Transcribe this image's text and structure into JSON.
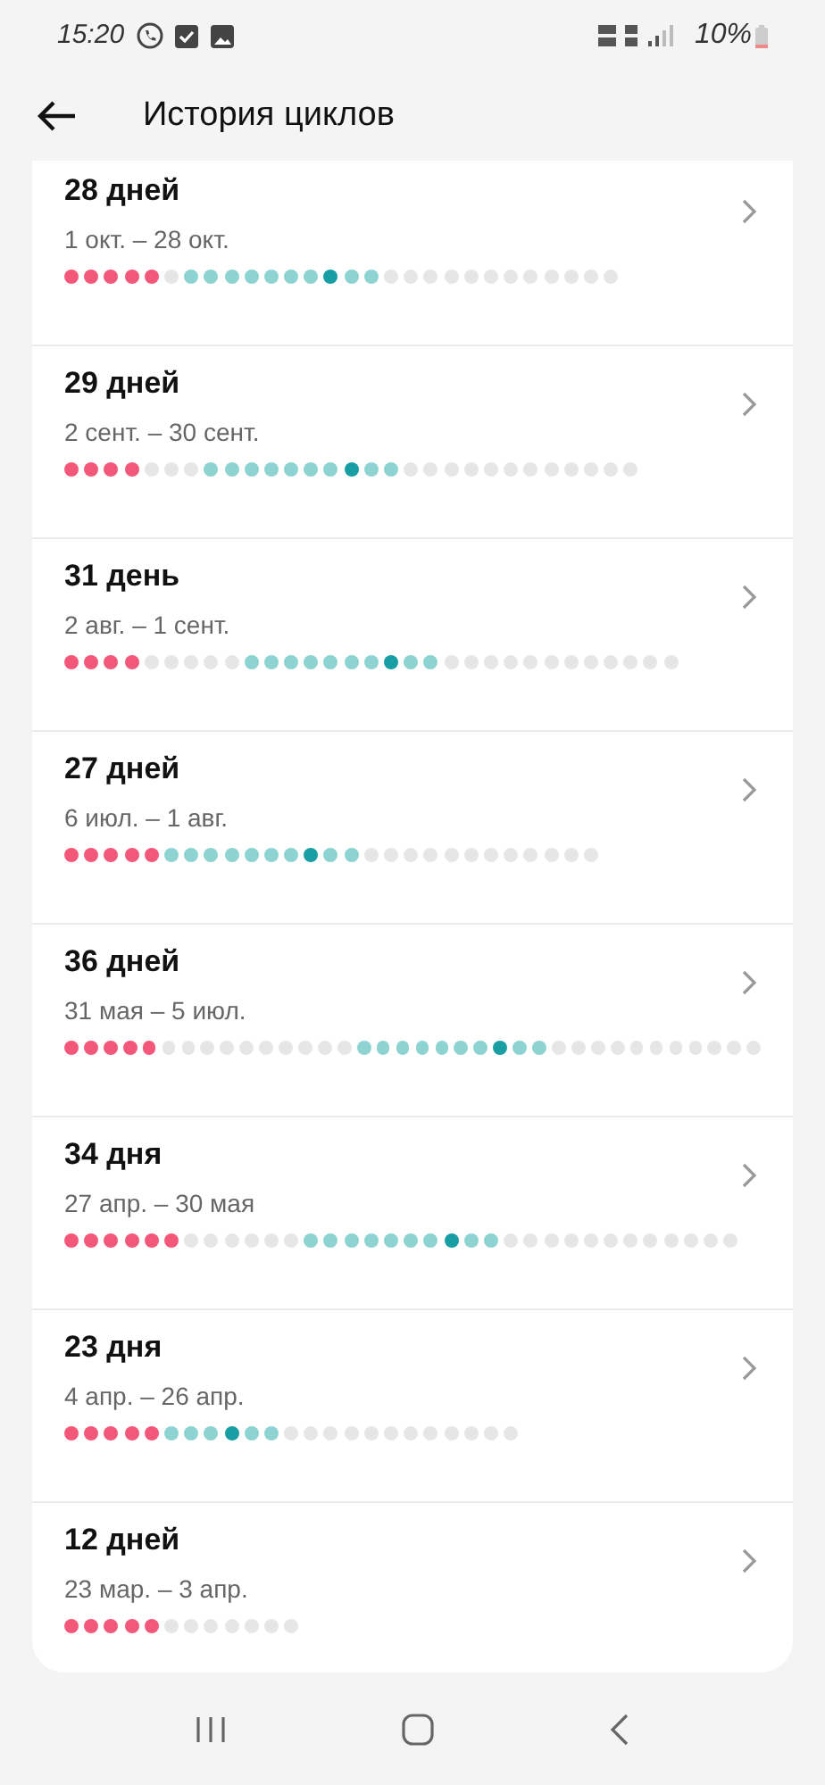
{
  "status_bar": {
    "time": "15:20",
    "battery": "10%"
  },
  "header": {
    "title": "История циклов"
  },
  "cycles": [
    {
      "length": "28 дней",
      "dates": "1 окт. – 28 окт.",
      "days": [
        {
          "kind": "period"
        },
        {
          "kind": "period"
        },
        {
          "kind": "period"
        },
        {
          "kind": "period"
        },
        {
          "kind": "period"
        },
        {
          "kind": "regular"
        },
        {
          "kind": "fertile"
        },
        {
          "kind": "fertile"
        },
        {
          "kind": "fertile"
        },
        {
          "kind": "fertile"
        },
        {
          "kind": "fertile"
        },
        {
          "kind": "fertile"
        },
        {
          "kind": "fertile"
        },
        {
          "kind": "ovulation"
        },
        {
          "kind": "fertile"
        },
        {
          "kind": "fertile"
        },
        {
          "kind": "regular"
        },
        {
          "kind": "regular"
        },
        {
          "kind": "regular"
        },
        {
          "kind": "regular"
        },
        {
          "kind": "regular"
        },
        {
          "kind": "regular"
        },
        {
          "kind": "regular"
        },
        {
          "kind": "regular"
        },
        {
          "kind": "regular"
        },
        {
          "kind": "regular"
        },
        {
          "kind": "regular"
        },
        {
          "kind": "regular"
        }
      ]
    },
    {
      "length": "29 дней",
      "dates": "2 сент. – 30 сент.",
      "days": [
        {
          "kind": "period"
        },
        {
          "kind": "period"
        },
        {
          "kind": "period"
        },
        {
          "kind": "period"
        },
        {
          "kind": "regular"
        },
        {
          "kind": "regular"
        },
        {
          "kind": "regular"
        },
        {
          "kind": "fertile"
        },
        {
          "kind": "fertile"
        },
        {
          "kind": "fertile"
        },
        {
          "kind": "fertile"
        },
        {
          "kind": "fertile"
        },
        {
          "kind": "fertile"
        },
        {
          "kind": "fertile"
        },
        {
          "kind": "ovulation"
        },
        {
          "kind": "fertile"
        },
        {
          "kind": "fertile"
        },
        {
          "kind": "regular"
        },
        {
          "kind": "regular"
        },
        {
          "kind": "regular"
        },
        {
          "kind": "regular"
        },
        {
          "kind": "regular"
        },
        {
          "kind": "regular"
        },
        {
          "kind": "regular"
        },
        {
          "kind": "regular"
        },
        {
          "kind": "regular"
        },
        {
          "kind": "regular"
        },
        {
          "kind": "regular"
        },
        {
          "kind": "regular"
        }
      ]
    },
    {
      "length": "31 день",
      "dates": "2 авг. – 1 сент.",
      "days": [
        {
          "kind": "period"
        },
        {
          "kind": "period"
        },
        {
          "kind": "period"
        },
        {
          "kind": "period"
        },
        {
          "kind": "regular"
        },
        {
          "kind": "regular"
        },
        {
          "kind": "regular"
        },
        {
          "kind": "regular"
        },
        {
          "kind": "regular"
        },
        {
          "kind": "fertile"
        },
        {
          "kind": "fertile"
        },
        {
          "kind": "fertile"
        },
        {
          "kind": "fertile"
        },
        {
          "kind": "fertile"
        },
        {
          "kind": "fertile"
        },
        {
          "kind": "fertile"
        },
        {
          "kind": "ovulation"
        },
        {
          "kind": "fertile"
        },
        {
          "kind": "fertile"
        },
        {
          "kind": "regular"
        },
        {
          "kind": "regular"
        },
        {
          "kind": "regular"
        },
        {
          "kind": "regular"
        },
        {
          "kind": "regular"
        },
        {
          "kind": "regular"
        },
        {
          "kind": "regular"
        },
        {
          "kind": "regular"
        },
        {
          "kind": "regular"
        },
        {
          "kind": "regular"
        },
        {
          "kind": "regular"
        },
        {
          "kind": "regular"
        }
      ]
    },
    {
      "length": "27 дней",
      "dates": "6 июл. – 1 авг.",
      "days": [
        {
          "kind": "period"
        },
        {
          "kind": "period"
        },
        {
          "kind": "period"
        },
        {
          "kind": "period"
        },
        {
          "kind": "period"
        },
        {
          "kind": "fertile"
        },
        {
          "kind": "fertile"
        },
        {
          "kind": "fertile"
        },
        {
          "kind": "fertile"
        },
        {
          "kind": "fertile"
        },
        {
          "kind": "fertile"
        },
        {
          "kind": "fertile"
        },
        {
          "kind": "ovulation"
        },
        {
          "kind": "fertile"
        },
        {
          "kind": "fertile"
        },
        {
          "kind": "regular"
        },
        {
          "kind": "regular"
        },
        {
          "kind": "regular"
        },
        {
          "kind": "regular"
        },
        {
          "kind": "regular"
        },
        {
          "kind": "regular"
        },
        {
          "kind": "regular"
        },
        {
          "kind": "regular"
        },
        {
          "kind": "regular"
        },
        {
          "kind": "regular"
        },
        {
          "kind": "regular"
        },
        {
          "kind": "regular"
        }
      ]
    },
    {
      "length": "36 дней",
      "dates": "31 мая – 5 июл.",
      "days": [
        {
          "kind": "period"
        },
        {
          "kind": "period"
        },
        {
          "kind": "period"
        },
        {
          "kind": "period"
        },
        {
          "kind": "period"
        },
        {
          "kind": "regular"
        },
        {
          "kind": "regular"
        },
        {
          "kind": "regular"
        },
        {
          "kind": "regular"
        },
        {
          "kind": "regular"
        },
        {
          "kind": "regular"
        },
        {
          "kind": "regular"
        },
        {
          "kind": "regular"
        },
        {
          "kind": "regular"
        },
        {
          "kind": "regular"
        },
        {
          "kind": "fertile"
        },
        {
          "kind": "fertile"
        },
        {
          "kind": "fertile"
        },
        {
          "kind": "fertile"
        },
        {
          "kind": "fertile"
        },
        {
          "kind": "fertile"
        },
        {
          "kind": "fertile"
        },
        {
          "kind": "ovulation"
        },
        {
          "kind": "fertile"
        },
        {
          "kind": "fertile"
        },
        {
          "kind": "regular"
        },
        {
          "kind": "regular"
        },
        {
          "kind": "regular"
        },
        {
          "kind": "regular"
        },
        {
          "kind": "regular"
        },
        {
          "kind": "regular"
        },
        {
          "kind": "regular"
        },
        {
          "kind": "regular"
        },
        {
          "kind": "regular"
        },
        {
          "kind": "regular"
        },
        {
          "kind": "regular"
        }
      ]
    },
    {
      "length": "34 дня",
      "dates": "27 апр. – 30 мая",
      "days": [
        {
          "kind": "period"
        },
        {
          "kind": "period"
        },
        {
          "kind": "period"
        },
        {
          "kind": "period"
        },
        {
          "kind": "period"
        },
        {
          "kind": "period"
        },
        {
          "kind": "regular"
        },
        {
          "kind": "regular"
        },
        {
          "kind": "regular"
        },
        {
          "kind": "regular"
        },
        {
          "kind": "regular"
        },
        {
          "kind": "regular"
        },
        {
          "kind": "fertile"
        },
        {
          "kind": "fertile"
        },
        {
          "kind": "fertile"
        },
        {
          "kind": "fertile"
        },
        {
          "kind": "fertile"
        },
        {
          "kind": "fertile"
        },
        {
          "kind": "fertile"
        },
        {
          "kind": "ovulation"
        },
        {
          "kind": "fertile"
        },
        {
          "kind": "fertile"
        },
        {
          "kind": "regular"
        },
        {
          "kind": "regular"
        },
        {
          "kind": "regular"
        },
        {
          "kind": "regular"
        },
        {
          "kind": "regular"
        },
        {
          "kind": "regular"
        },
        {
          "kind": "regular"
        },
        {
          "kind": "regular"
        },
        {
          "kind": "regular"
        },
        {
          "kind": "regular"
        },
        {
          "kind": "regular"
        },
        {
          "kind": "regular"
        }
      ]
    },
    {
      "length": "23 дня",
      "dates": "4 апр. – 26 апр.",
      "days": [
        {
          "kind": "period"
        },
        {
          "kind": "period"
        },
        {
          "kind": "period"
        },
        {
          "kind": "period"
        },
        {
          "kind": "period"
        },
        {
          "kind": "fertile"
        },
        {
          "kind": "fertile"
        },
        {
          "kind": "fertile"
        },
        {
          "kind": "ovulation"
        },
        {
          "kind": "fertile"
        },
        {
          "kind": "fertile"
        },
        {
          "kind": "regular"
        },
        {
          "kind": "regular"
        },
        {
          "kind": "regular"
        },
        {
          "kind": "regular"
        },
        {
          "kind": "regular"
        },
        {
          "kind": "regular"
        },
        {
          "kind": "regular"
        },
        {
          "kind": "regular"
        },
        {
          "kind": "regular"
        },
        {
          "kind": "regular"
        },
        {
          "kind": "regular"
        },
        {
          "kind": "regular"
        }
      ]
    },
    {
      "length": "12 дней",
      "dates": "23 мар. – 3 апр.",
      "days": [
        {
          "kind": "period"
        },
        {
          "kind": "period"
        },
        {
          "kind": "period"
        },
        {
          "kind": "period"
        },
        {
          "kind": "period"
        },
        {
          "kind": "regular"
        },
        {
          "kind": "regular"
        },
        {
          "kind": "regular"
        },
        {
          "kind": "regular"
        },
        {
          "kind": "regular"
        },
        {
          "kind": "regular"
        },
        {
          "kind": "regular"
        }
      ]
    }
  ]
}
